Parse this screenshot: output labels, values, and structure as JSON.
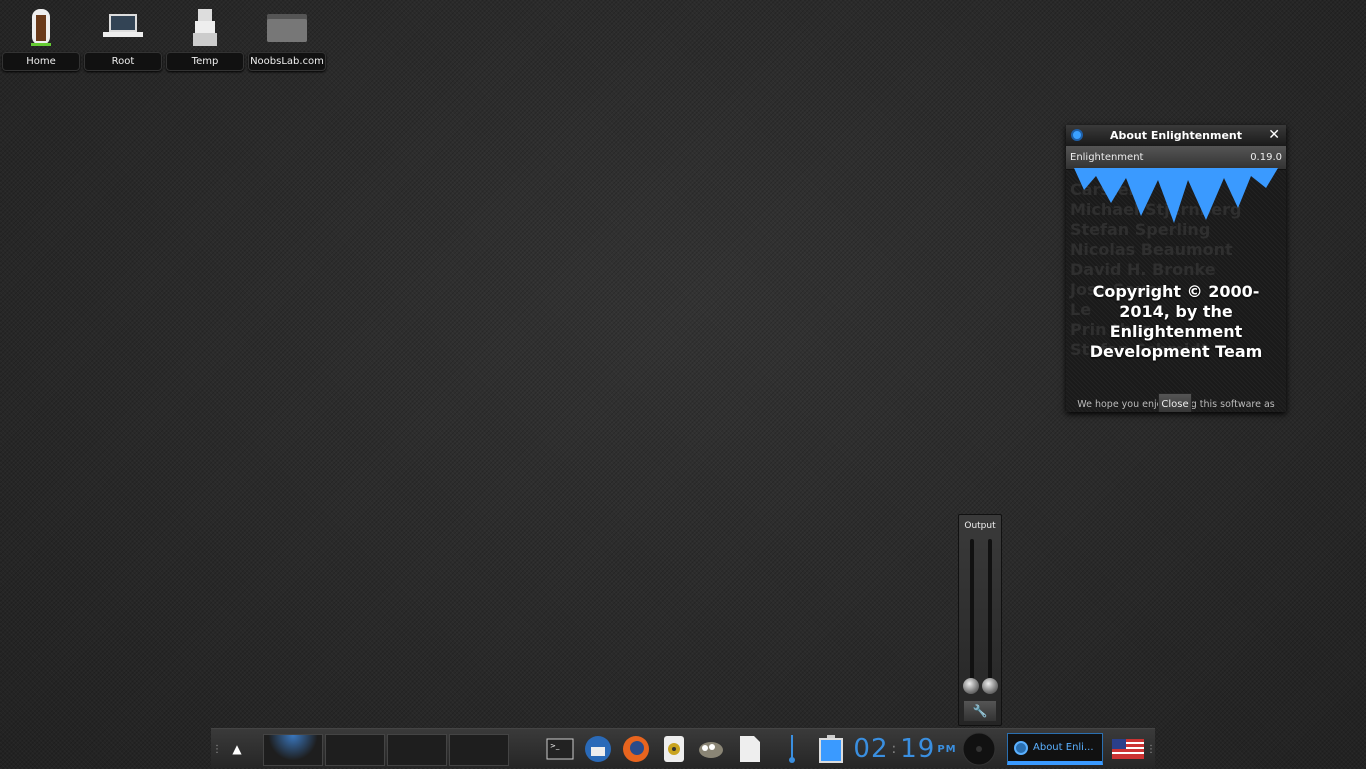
{
  "desktop": {
    "icons": [
      {
        "label": "Home"
      },
      {
        "label": "Root"
      },
      {
        "label": "Temp"
      },
      {
        "label": "NoobsLab.com"
      }
    ]
  },
  "about": {
    "title": "About Enlightenment",
    "name": "Enlightenment",
    "version": "0.19.0",
    "credits": [
      "Carsten",
      "Michael Stjernberg",
      "Stefan Sperling",
      "Nicolas Beaumont",
      "David H. Bronke",
      "Jose Souza",
      "Le",
      "Prin thor",
      "Stefan Schmidt"
    ],
    "copyright": "Copyright © 2000-2014, by the Enlightenment Development Team",
    "message": "We hope you enjoy using this software as much as we enjoyed writing it.",
    "close_label": "Close"
  },
  "mixer": {
    "title": "Output",
    "left_level": 0,
    "right_level": 0
  },
  "shelf": {
    "clock_h": "02",
    "clock_m": "19",
    "ampm": "PM",
    "task_label": "About Enli..."
  }
}
